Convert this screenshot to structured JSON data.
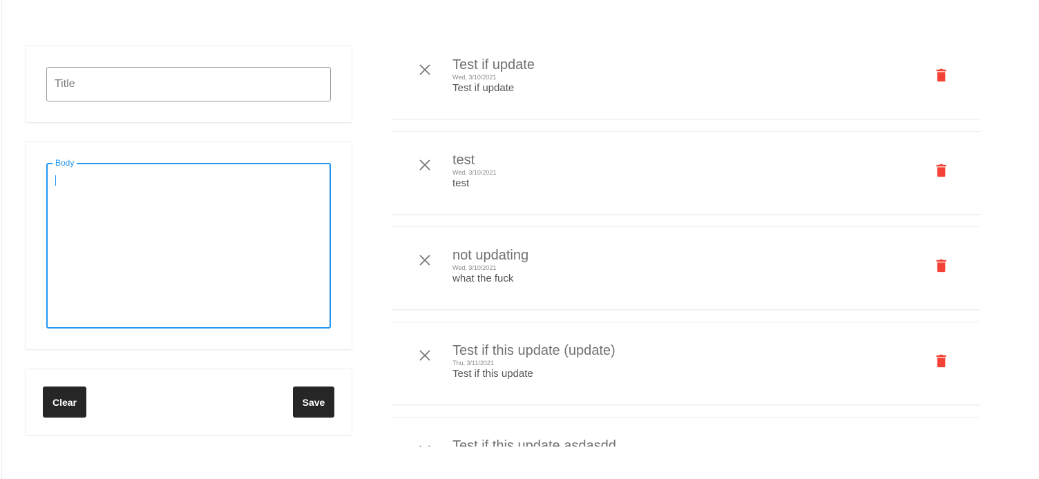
{
  "editor": {
    "title_placeholder": "Title",
    "title_value": "",
    "body_label": "Body",
    "body_value": "",
    "clear_label": "Clear",
    "save_label": "Save"
  },
  "colors": {
    "focus_accent": "#2196f3",
    "button_bg": "#262626",
    "delete_icon": "#f44336"
  },
  "icons": {
    "remove": "close-icon",
    "delete": "trash-icon"
  },
  "notes": [
    {
      "title": "Test if update",
      "date": "Wed, 3/10/2021",
      "body": "Test if update"
    },
    {
      "title": "test",
      "date": "Wed, 3/10/2021",
      "body": "test"
    },
    {
      "title": "not updating",
      "date": "Wed, 3/10/2021",
      "body": "what the fuck"
    },
    {
      "title": "Test if this update (update)",
      "date": "Thu, 3/11/2021",
      "body": "Test if this update"
    },
    {
      "title": "Test if this update asdasdd",
      "date": "",
      "body": ""
    }
  ]
}
